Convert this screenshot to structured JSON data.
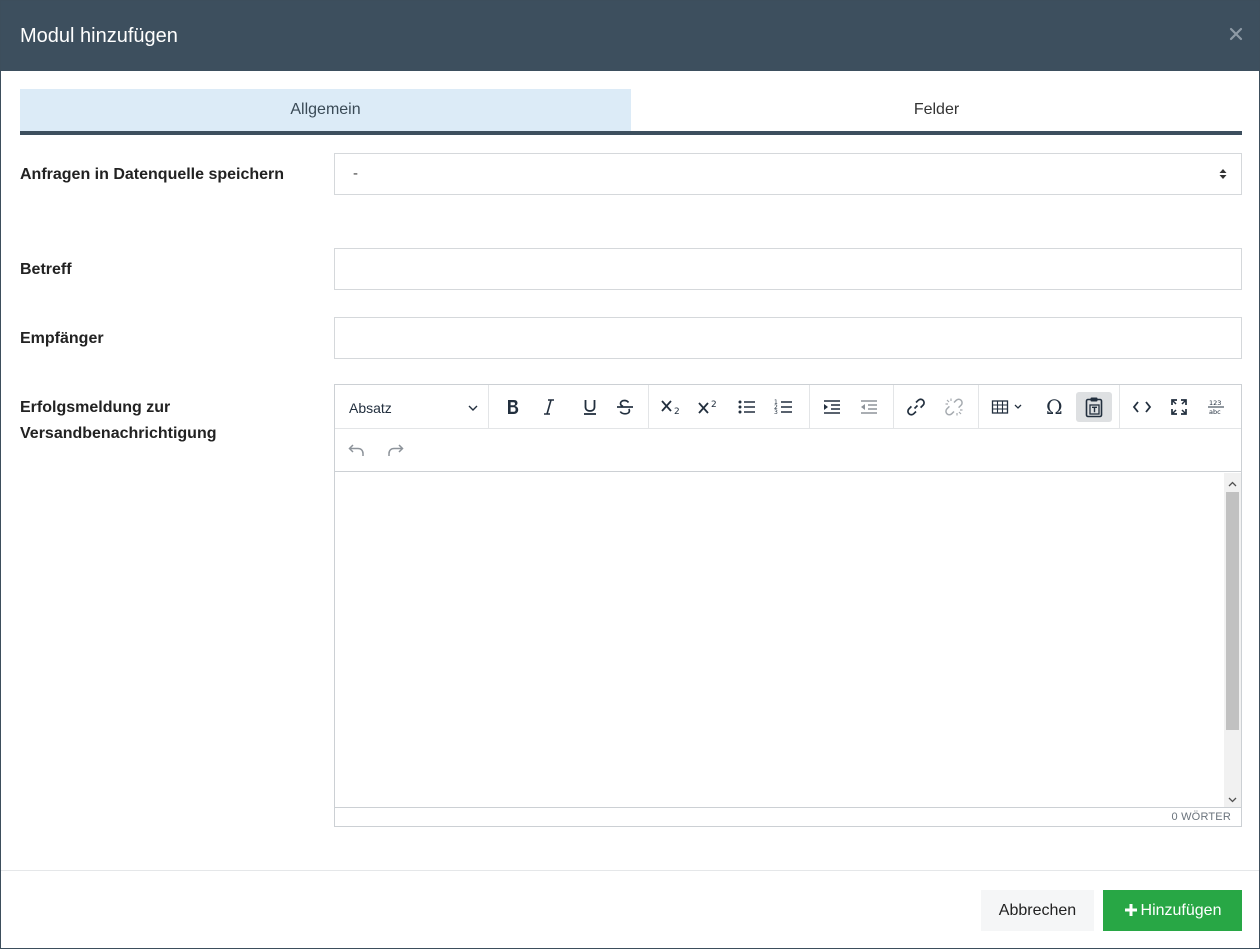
{
  "dialog": {
    "title": "Modul hinzufügen",
    "close_icon": "close-icon"
  },
  "tabs": [
    {
      "label": "Allgemein",
      "active": true
    },
    {
      "label": "Felder",
      "active": false
    }
  ],
  "form": {
    "datasource": {
      "label": "Anfragen in Datenquelle speichern",
      "value": "-"
    },
    "subject": {
      "label": "Betreff",
      "value": ""
    },
    "recipient": {
      "label": "Empfänger",
      "value": ""
    },
    "success_message": {
      "label": "Erfolgsmeldung zur Versandbenachrichtigung"
    }
  },
  "editor": {
    "block_format": "Absatz",
    "toolbar_icons": [
      "bold-icon",
      "italic-icon",
      "underline-icon",
      "strikethrough-icon",
      "subscript-icon",
      "superscript-icon",
      "bullet-list-icon",
      "numbered-list-icon",
      "indent-icon",
      "outdent-icon",
      "link-icon",
      "unlink-icon",
      "table-icon",
      "special-character-icon",
      "paste-as-text-icon",
      "source-code-icon",
      "fullscreen-icon",
      "wordcount-icon",
      "undo-icon",
      "redo-icon"
    ],
    "word_count": "0 WÖRTER"
  },
  "footer": {
    "cancel_label": "Abbrechen",
    "add_label": "Hinzufügen"
  },
  "colors": {
    "header": "#3d4f5e",
    "active_tab": "#dcebf7",
    "add_button": "#28a745"
  }
}
